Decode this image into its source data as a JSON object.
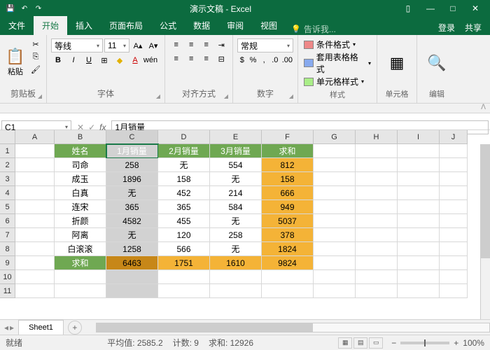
{
  "title": "演示文稿 - Excel",
  "titlebar_icons": {
    "save": "💾",
    "undo": "↶",
    "redo": "↷"
  },
  "winbtns": {
    "opts": "▯",
    "min": "—",
    "max": "□",
    "close": "✕"
  },
  "tabs": {
    "file": "文件",
    "home": "开始",
    "insert": "插入",
    "pagelayout": "页面布局",
    "formulas": "公式",
    "data": "数据",
    "review": "审阅",
    "view": "视图"
  },
  "tellme": "告诉我...",
  "login": "登录",
  "share": "共享",
  "ribbon": {
    "clipboard": {
      "paste": "粘贴",
      "label": "剪贴板",
      "cut": "✂",
      "copy": "⎘",
      "brush": "🖌"
    },
    "font": {
      "name": "等线",
      "size": "11",
      "bold": "B",
      "italic": "I",
      "underline": "U",
      "border": "⊞",
      "shade": "◆",
      "color": "A",
      "grow": "A▴",
      "shrink": "A▾",
      "phon": "wén",
      "label": "字体"
    },
    "align": {
      "label": "对齐方式",
      "l": "≡",
      "c": "≡",
      "r": "≡",
      "wrap": "⇥",
      "merge": "⊟"
    },
    "number": {
      "fmt": "常规",
      "label": "数字",
      "cur": "$",
      "pct": "%",
      "comma": ",",
      "inc": ".0",
      "dec": ".00"
    },
    "styles": {
      "cond": "条件格式",
      "table": "套用表格格式",
      "cell": "单元格样式",
      "label": "样式"
    },
    "cells": {
      "label": "单元格"
    },
    "edit": {
      "label": "编辑"
    }
  },
  "namebox": "C1",
  "formula": "1月销量",
  "cols": [
    "A",
    "B",
    "C",
    "D",
    "E",
    "F",
    "G",
    "H",
    "I",
    "J"
  ],
  "rows": [
    "1",
    "2",
    "3",
    "4",
    "5",
    "6",
    "7",
    "8",
    "9",
    "10",
    "11"
  ],
  "headers": {
    "b": "姓名",
    "c": "1月销量",
    "d": "2月销量",
    "e": "3月销量",
    "f": "求和"
  },
  "data": [
    {
      "b": "司命",
      "c": "258",
      "d": "无",
      "e": "554",
      "f": "812"
    },
    {
      "b": "成玉",
      "c": "1896",
      "d": "158",
      "e": "无",
      "f": "158"
    },
    {
      "b": "白真",
      "c": "无",
      "d": "452",
      "e": "214",
      "f": "666"
    },
    {
      "b": "连宋",
      "c": "365",
      "d": "365",
      "e": "584",
      "f": "949"
    },
    {
      "b": "折颜",
      "c": "4582",
      "d": "455",
      "e": "无",
      "f": "5037"
    },
    {
      "b": "阿离",
      "c": "无",
      "d": "120",
      "e": "258",
      "f": "378"
    },
    {
      "b": "白滚滚",
      "c": "1258",
      "d": "566",
      "e": "无",
      "f": "1824"
    }
  ],
  "sumrow": {
    "b": "求和",
    "c": "6463",
    "d": "1751",
    "e": "1610",
    "f": "9824"
  },
  "sheet": "Sheet1",
  "status": {
    "ready": "就绪",
    "avg": "平均值: 2585.2",
    "count": "计数: 9",
    "sum": "求和: 12926",
    "zoom": "100%"
  }
}
